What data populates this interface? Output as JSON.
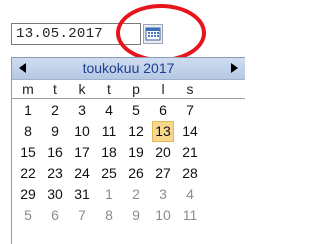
{
  "date_input": {
    "value": "13.05.2017"
  },
  "calendar_button": {
    "icon": "calendar-icon"
  },
  "popup": {
    "month_title": "toukokuu 2017",
    "nav": {
      "prev_icon": "arrow-left-icon",
      "next_icon": "arrow-right-icon"
    },
    "weekdays": [
      "m",
      "t",
      "k",
      "t",
      "p",
      "l",
      "s"
    ],
    "weeks": [
      [
        {
          "d": "1"
        },
        {
          "d": "2"
        },
        {
          "d": "3"
        },
        {
          "d": "4"
        },
        {
          "d": "5"
        },
        {
          "d": "6"
        },
        {
          "d": "7"
        }
      ],
      [
        {
          "d": "8"
        },
        {
          "d": "9"
        },
        {
          "d": "10"
        },
        {
          "d": "11"
        },
        {
          "d": "12"
        },
        {
          "d": "13",
          "selected": true
        },
        {
          "d": "14"
        }
      ],
      [
        {
          "d": "15"
        },
        {
          "d": "16"
        },
        {
          "d": "17"
        },
        {
          "d": "18"
        },
        {
          "d": "19"
        },
        {
          "d": "20"
        },
        {
          "d": "21"
        }
      ],
      [
        {
          "d": "22"
        },
        {
          "d": "23"
        },
        {
          "d": "24"
        },
        {
          "d": "25"
        },
        {
          "d": "26"
        },
        {
          "d": "27"
        },
        {
          "d": "28"
        }
      ],
      [
        {
          "d": "29"
        },
        {
          "d": "30"
        },
        {
          "d": "31"
        },
        {
          "d": "1",
          "other": true
        },
        {
          "d": "2",
          "other": true
        },
        {
          "d": "3",
          "other": true
        },
        {
          "d": "4",
          "other": true
        }
      ],
      [
        {
          "d": "5",
          "other": true
        },
        {
          "d": "6",
          "other": true
        },
        {
          "d": "7",
          "other": true
        },
        {
          "d": "8",
          "other": true
        },
        {
          "d": "9",
          "other": true
        },
        {
          "d": "10",
          "other": true
        },
        {
          "d": "11",
          "other": true
        }
      ]
    ]
  },
  "colors": {
    "highlight_circle": "#e8141b",
    "selected_day_bg": "#f7d78b",
    "header_text": "#1f3f8f",
    "other_month_text": "#8c8c8c"
  }
}
